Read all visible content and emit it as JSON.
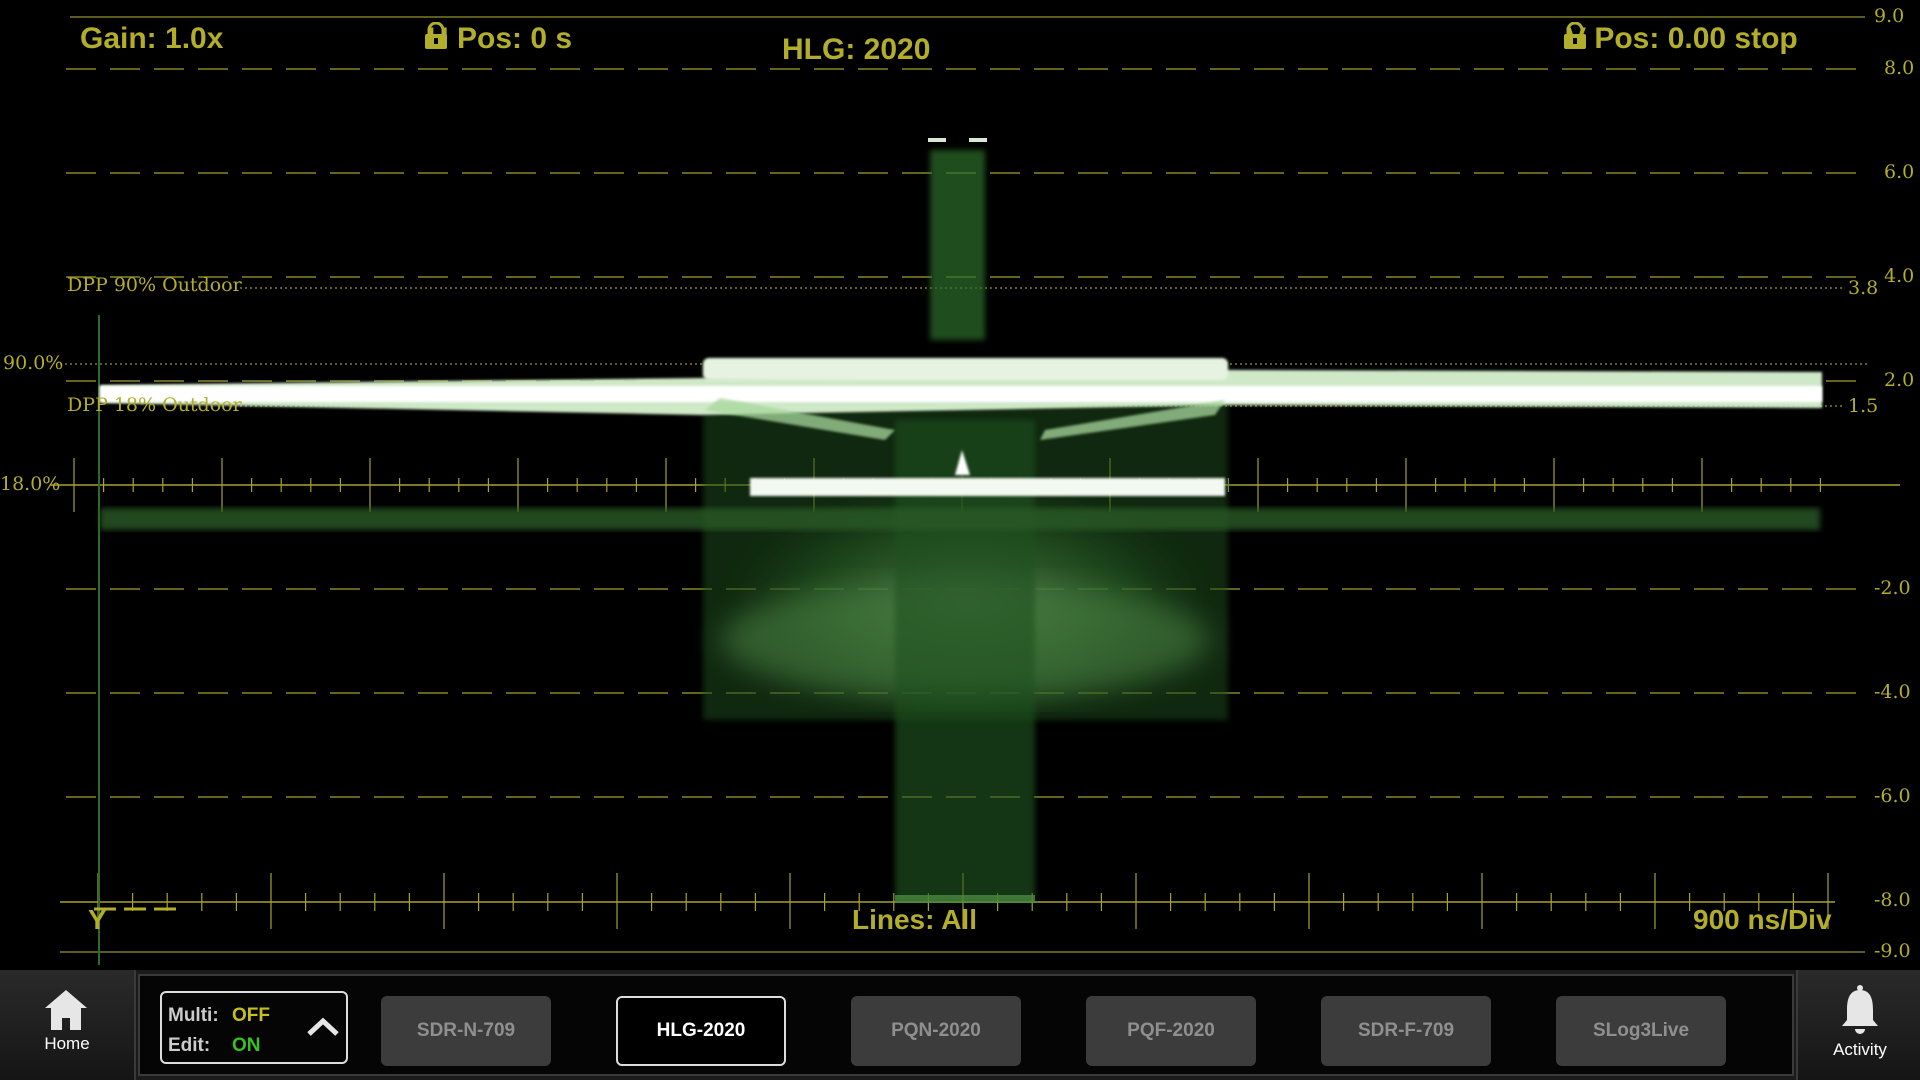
{
  "header": {
    "gain": "Gain: 1.0x",
    "h_pos": "H Pos: 0 s",
    "mode": "HLG: 2020",
    "v_pos": "V Pos: 0.00 stop"
  },
  "right_scale": [
    "9.0",
    "8.0",
    "6.0",
    "4.0",
    "3.8",
    "2.0",
    "1.5",
    "-2.0",
    "-4.0",
    "-6.0",
    "-8.0",
    "-9.0"
  ],
  "graticule_labels": {
    "dpp90": "DPP 90% Outdoor",
    "dpp18": "DPP 18% Outdoor",
    "pct90": "90.0%",
    "pct18": "18.0%"
  },
  "footer": {
    "channel": "Y",
    "lines": "Lines: All",
    "timebase": "900 ns/Div"
  },
  "bottom_bar": {
    "home_label": "Home",
    "multi_key": "Multi:",
    "multi_value": "OFF",
    "edit_key": "Edit:",
    "edit_value": "ON",
    "presets": [
      "SDR-N-709",
      "HLG-2020",
      "PQN-2020",
      "PQF-2020",
      "SDR-F-709",
      "SLog3Live"
    ],
    "selected_preset": "HLG-2020",
    "activity_label": "Activity"
  },
  "colors": {
    "graticule": "#b3ad2c",
    "trace": "#6bbd5a",
    "multi_off": "#c8bd1e",
    "edit_on": "#39c020"
  }
}
